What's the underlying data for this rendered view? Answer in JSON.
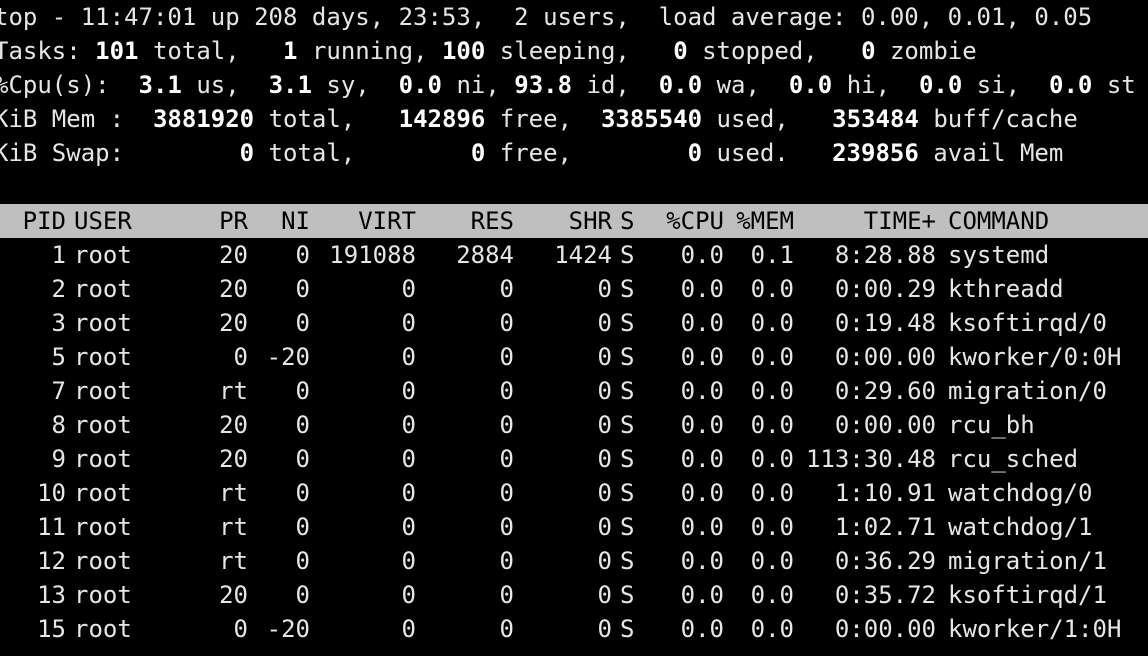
{
  "summary": {
    "uptime_line": "top - 11:47:01 up 208 days, 23:53,  2 users,  load average: 0.00, 0.01, 0.05",
    "tasks": {
      "label": "Tasks:",
      "total": "101",
      "total_label": "total,",
      "running": "1",
      "running_label": "running,",
      "sleeping": "100",
      "sleeping_label": "sleeping,",
      "stopped": "0",
      "stopped_label": "stopped,",
      "zombie": "0",
      "zombie_label": "zombie"
    },
    "cpu": {
      "label": "%Cpu(s):",
      "us": "3.1",
      "us_label": "us,",
      "sy": "3.1",
      "sy_label": "sy,",
      "ni": "0.0",
      "ni_label": "ni,",
      "id": "93.8",
      "id_label": "id,",
      "wa": "0.0",
      "wa_label": "wa,",
      "hi": "0.0",
      "hi_label": "hi,",
      "si": "0.0",
      "si_label": "si,",
      "st": "0.0",
      "st_label": "st"
    },
    "mem": {
      "label": "KiB Mem :",
      "total": "3881920",
      "total_label": "total,",
      "free": "142896",
      "free_label": "free,",
      "used": "3385540",
      "used_label": "used,",
      "buff": "353484",
      "buff_label": "buff/cache"
    },
    "swap": {
      "label": "KiB Swap:",
      "total": "0",
      "total_label": "total,",
      "free": "0",
      "free_label": "free,",
      "used": "0",
      "used_label": "used.",
      "avail": "239856",
      "avail_label": "avail Mem"
    }
  },
  "columns": {
    "pid": "PID",
    "user": "USER",
    "pr": "PR",
    "ni": "NI",
    "virt": "VIRT",
    "res": "RES",
    "shr": "SHR",
    "s": "S",
    "cpu": "%CPU",
    "mem": "%MEM",
    "time": "TIME+",
    "command": "COMMAND"
  },
  "processes": [
    {
      "pid": "1",
      "user": "root",
      "pr": "20",
      "ni": "0",
      "virt": "191088",
      "res": "2884",
      "shr": "1424",
      "s": "S",
      "cpu": "0.0",
      "mem": "0.1",
      "time": "8:28.88",
      "command": "systemd"
    },
    {
      "pid": "2",
      "user": "root",
      "pr": "20",
      "ni": "0",
      "virt": "0",
      "res": "0",
      "shr": "0",
      "s": "S",
      "cpu": "0.0",
      "mem": "0.0",
      "time": "0:00.29",
      "command": "kthreadd"
    },
    {
      "pid": "3",
      "user": "root",
      "pr": "20",
      "ni": "0",
      "virt": "0",
      "res": "0",
      "shr": "0",
      "s": "S",
      "cpu": "0.0",
      "mem": "0.0",
      "time": "0:19.48",
      "command": "ksoftirqd/0"
    },
    {
      "pid": "5",
      "user": "root",
      "pr": "0",
      "ni": "-20",
      "virt": "0",
      "res": "0",
      "shr": "0",
      "s": "S",
      "cpu": "0.0",
      "mem": "0.0",
      "time": "0:00.00",
      "command": "kworker/0:0H"
    },
    {
      "pid": "7",
      "user": "root",
      "pr": "rt",
      "ni": "0",
      "virt": "0",
      "res": "0",
      "shr": "0",
      "s": "S",
      "cpu": "0.0",
      "mem": "0.0",
      "time": "0:29.60",
      "command": "migration/0"
    },
    {
      "pid": "8",
      "user": "root",
      "pr": "20",
      "ni": "0",
      "virt": "0",
      "res": "0",
      "shr": "0",
      "s": "S",
      "cpu": "0.0",
      "mem": "0.0",
      "time": "0:00.00",
      "command": "rcu_bh"
    },
    {
      "pid": "9",
      "user": "root",
      "pr": "20",
      "ni": "0",
      "virt": "0",
      "res": "0",
      "shr": "0",
      "s": "S",
      "cpu": "0.0",
      "mem": "0.0",
      "time": "113:30.48",
      "command": "rcu_sched"
    },
    {
      "pid": "10",
      "user": "root",
      "pr": "rt",
      "ni": "0",
      "virt": "0",
      "res": "0",
      "shr": "0",
      "s": "S",
      "cpu": "0.0",
      "mem": "0.0",
      "time": "1:10.91",
      "command": "watchdog/0"
    },
    {
      "pid": "11",
      "user": "root",
      "pr": "rt",
      "ni": "0",
      "virt": "0",
      "res": "0",
      "shr": "0",
      "s": "S",
      "cpu": "0.0",
      "mem": "0.0",
      "time": "1:02.71",
      "command": "watchdog/1"
    },
    {
      "pid": "12",
      "user": "root",
      "pr": "rt",
      "ni": "0",
      "virt": "0",
      "res": "0",
      "shr": "0",
      "s": "S",
      "cpu": "0.0",
      "mem": "0.0",
      "time": "0:36.29",
      "command": "migration/1"
    },
    {
      "pid": "13",
      "user": "root",
      "pr": "20",
      "ni": "0",
      "virt": "0",
      "res": "0",
      "shr": "0",
      "s": "S",
      "cpu": "0.0",
      "mem": "0.0",
      "time": "0:35.72",
      "command": "ksoftirqd/1"
    },
    {
      "pid": "15",
      "user": "root",
      "pr": "0",
      "ni": "-20",
      "virt": "0",
      "res": "0",
      "shr": "0",
      "s": "S",
      "cpu": "0.0",
      "mem": "0.0",
      "time": "0:00.00",
      "command": "kworker/1:0H"
    }
  ],
  "colors": {
    "background": "#000000",
    "text": "#e6e6e6",
    "header_bar": "#bfbfbf"
  }
}
